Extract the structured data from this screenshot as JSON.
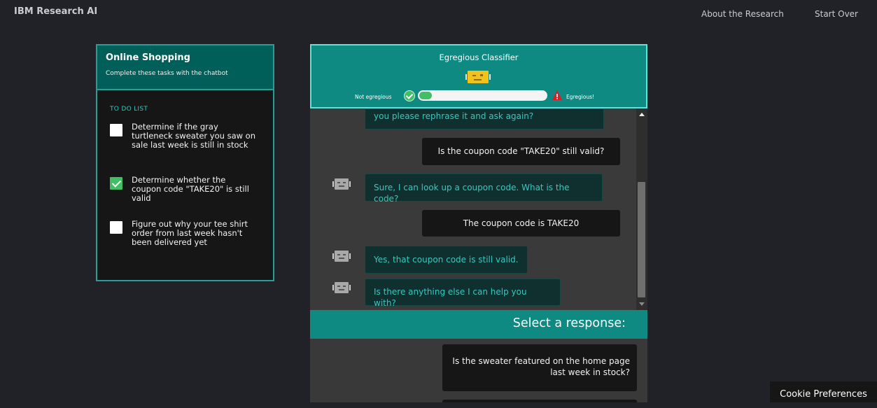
{
  "header": {
    "brand": "IBM Research AI",
    "nav": {
      "about": "About the Research",
      "start_over": "Start Over"
    }
  },
  "task_panel": {
    "title": "Online Shopping",
    "subtitle": "Complete these tasks with the chatbot",
    "todo_label": "TO DO LIST",
    "items": [
      {
        "text": "Determine if the gray turtleneck sweater you saw on sale last week is still in stock",
        "checked": false
      },
      {
        "text": "Determine whether the coupon code \"TAKE20\" is still valid",
        "checked": true
      },
      {
        "text": "Figure out why your tee shirt order from last week hasn't been delivered yet",
        "checked": false
      }
    ]
  },
  "classifier": {
    "title": "Egregious Classifier",
    "low_label": "Not egregious",
    "high_label": "Egregious!",
    "level": 0.1,
    "icons": [
      "check-circle-icon",
      "warning-triangle-icon",
      "robot-face-icon"
    ]
  },
  "chat": {
    "messages": [
      {
        "from": "bot",
        "text": "you please rephrase it and ask again?"
      },
      {
        "from": "user",
        "text": "Is the coupon code \"TAKE20\" still valid?"
      },
      {
        "from": "bot",
        "text": "Sure, I can look up a coupon code. What is the code?"
      },
      {
        "from": "user",
        "text": "The coupon code is TAKE20"
      },
      {
        "from": "bot",
        "text": "Yes, that coupon code is still valid."
      },
      {
        "from": "bot",
        "text": "Is there anything else I can help you with?"
      }
    ]
  },
  "responses": {
    "label": "Select a response:",
    "options": [
      {
        "line1": "Is the sweater featured on the home page",
        "line2": "last week in stock?"
      }
    ]
  },
  "cookie": {
    "label": "Cookie Preferences"
  },
  "colors": {
    "teal": "#0e8a82",
    "teal_dark": "#015f5a",
    "green": "#42be65",
    "warning": "#da1e28"
  }
}
